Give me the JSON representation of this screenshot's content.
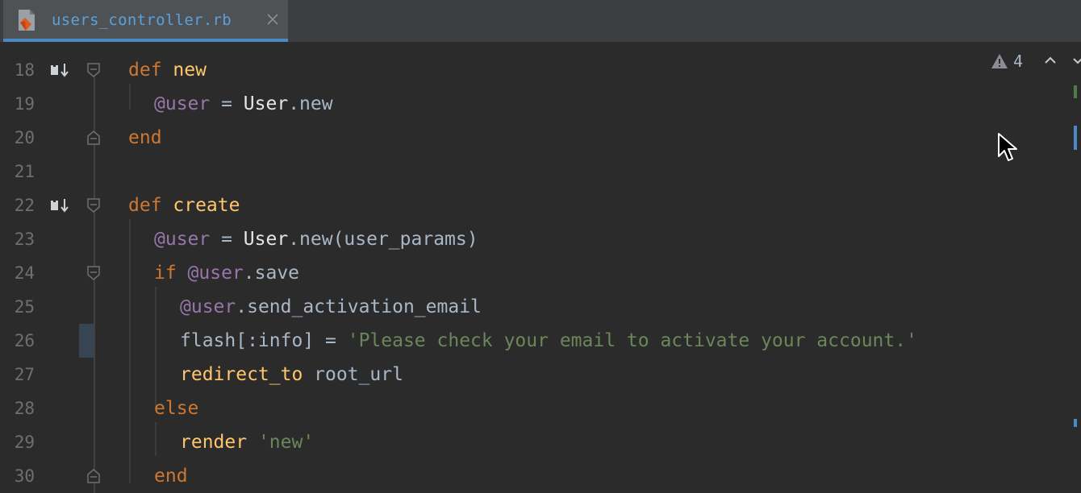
{
  "tab": {
    "filename": "users_controller.rb",
    "active": true
  },
  "inspections": {
    "warning_count": "4"
  },
  "lines": [
    {
      "num": "18",
      "tokens": [
        [
          "kw",
          "def "
        ],
        [
          "fn",
          "new"
        ]
      ]
    },
    {
      "num": "19",
      "tokens": [
        [
          "iv",
          "@user"
        ],
        [
          "dim",
          " = "
        ],
        [
          "cst",
          "User"
        ],
        [
          "dim",
          ".new"
        ]
      ]
    },
    {
      "num": "20",
      "tokens": [
        [
          "kw",
          "end"
        ]
      ]
    },
    {
      "num": "21",
      "tokens": []
    },
    {
      "num": "22",
      "tokens": [
        [
          "kw",
          "def "
        ],
        [
          "fn",
          "create"
        ]
      ]
    },
    {
      "num": "23",
      "tokens": [
        [
          "iv",
          "@user"
        ],
        [
          "dim",
          " = "
        ],
        [
          "cst",
          "User"
        ],
        [
          "dim",
          ".new(user_params)"
        ]
      ]
    },
    {
      "num": "24",
      "tokens": [
        [
          "kw",
          "if "
        ],
        [
          "iv",
          "@user"
        ],
        [
          "dim",
          ".save"
        ]
      ]
    },
    {
      "num": "25",
      "tokens": [
        [
          "iv",
          "@user"
        ],
        [
          "dim",
          ".send_activation_email"
        ]
      ]
    },
    {
      "num": "26",
      "tokens": [
        [
          "dim",
          "flash[:info] = "
        ],
        [
          "str",
          "'Please check your email to activate your account.'"
        ]
      ]
    },
    {
      "num": "27",
      "tokens": [
        [
          "fn",
          "redirect_to "
        ],
        [
          "dim",
          "root_url"
        ]
      ]
    },
    {
      "num": "28",
      "tokens": [
        [
          "kw",
          "else"
        ]
      ]
    },
    {
      "num": "29",
      "tokens": [
        [
          "fn",
          "render "
        ],
        [
          "str",
          "'new'"
        ]
      ]
    },
    {
      "num": "30",
      "tokens": [
        [
          "kw",
          "end"
        ]
      ]
    }
  ],
  "colors": {
    "background": "#2b2b2b",
    "keyword": "#cc7832",
    "function": "#ffc66d",
    "instance_var": "#9876aa",
    "string": "#6a8759",
    "tab_accent": "#4a88c7"
  }
}
